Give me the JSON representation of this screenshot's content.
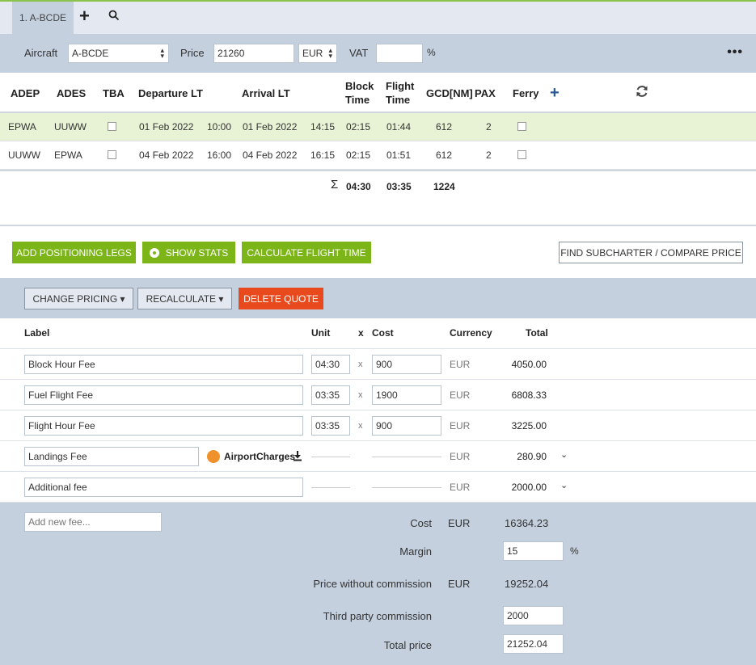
{
  "tabs": {
    "active_label": "1. A-BCDE",
    "add_label": "+"
  },
  "aircraft_bar": {
    "aircraft_label": "Aircraft",
    "aircraft_value": "A-BCDE",
    "price_label": "Price",
    "price_value": "21260",
    "currency_value": "EUR",
    "vat_label": "VAT",
    "vat_value": "",
    "vat_unit": "%",
    "more_label": "•••"
  },
  "legs_header": {
    "adep": "ADEP",
    "ades": "ADES",
    "tba": "TBA",
    "departure": "Departure LT",
    "arrival": "Arrival LT",
    "block_time_1": "Block",
    "block_time_2": "Time",
    "flight_time_1": "Flight",
    "flight_time_2": "Time",
    "gcd": "GCD[NM]",
    "pax": "PAX",
    "ferry": "Ferry",
    "add_label": "+"
  },
  "legs": [
    {
      "adep": "EPWA",
      "ades": "UUWW",
      "dep_date": "01 Feb 2022",
      "dep_time": "10:00",
      "arr_date": "01 Feb 2022",
      "arr_time": "14:15",
      "block": "02:15",
      "flight": "01:44",
      "gcd": "612",
      "pax": "2"
    },
    {
      "adep": "UUWW",
      "ades": "EPWA",
      "dep_date": "04 Feb 2022",
      "dep_time": "16:00",
      "arr_date": "04 Feb 2022",
      "arr_time": "16:15",
      "block": "02:15",
      "flight": "01:51",
      "gcd": "612",
      "pax": "2"
    }
  ],
  "sums": {
    "sigma": "Σ",
    "block": "04:30",
    "flight": "03:35",
    "gcd": "1224"
  },
  "actions": {
    "positioning": "ADD POSITIONING LEGS",
    "stats": "SHOW STATS",
    "calc": "CALCULATE FLIGHT TIME",
    "subcharter": "FIND SUBCHARTER / COMPARE PRICE"
  },
  "pricing_bar": {
    "change": "CHANGE PRICING ▾",
    "recalc": "RECALCULATE ▾",
    "delete": "DELETE QUOTE"
  },
  "fee_header": {
    "label": "Label",
    "unit": "Unit",
    "x": "x",
    "cost": "Cost",
    "currency": "Currency",
    "total": "Total"
  },
  "fees": [
    {
      "label": "Block Hour Fee",
      "unit": "04:30",
      "x": "x",
      "cost": "900",
      "currency": "EUR",
      "total": "4050.00"
    },
    {
      "label": "Fuel Flight Fee",
      "unit": "03:35",
      "x": "x",
      "cost": "1900",
      "currency": "EUR",
      "total": "6808.33"
    },
    {
      "label": "Flight Hour Fee",
      "unit": "03:35",
      "x": "x",
      "cost": "900",
      "currency": "EUR",
      "total": "3225.00"
    },
    {
      "label": "Landings Fee",
      "provider": "AirportCharges",
      "currency": "EUR",
      "total": "280.90",
      "chevron": "⌄"
    },
    {
      "label": "Additional fee",
      "currency": "EUR",
      "total": "2000.00",
      "chevron": "⌄"
    }
  ],
  "footer": {
    "new_fee_placeholder": "Add new fee...",
    "cost_label": "Cost",
    "cost_currency": "EUR",
    "cost_value": "16364.23",
    "margin_label": "Margin",
    "margin_value": "15",
    "margin_unit": "%",
    "pwc_label": "Price without commission",
    "pwc_currency": "EUR",
    "pwc_value": "19252.04",
    "tpc_label": "Third party commission",
    "tpc_value": "2000",
    "total_label": "Total price",
    "total_value": "21252.04"
  },
  "icons": {
    "search": "search-icon",
    "refresh": "refresh-icon",
    "download": "download-icon",
    "accent_green": "#7cb518",
    "accent_red": "#e8491d",
    "accent_blue": "#2a5a96"
  }
}
